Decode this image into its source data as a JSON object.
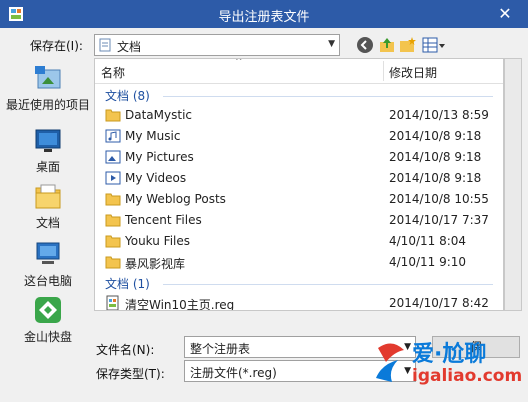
{
  "window": {
    "title": "导出注册表文件",
    "close_label": "✕"
  },
  "toolbar": {
    "save_in_label": "保存在(I):",
    "save_in_value": "文档"
  },
  "places": [
    {
      "label": "最近使用的项目",
      "icon": "recent-items-icon"
    },
    {
      "label": "桌面",
      "icon": "desktop-icon"
    },
    {
      "label": "文档",
      "icon": "documents-icon"
    },
    {
      "label": "这台电脑",
      "icon": "computer-icon"
    },
    {
      "label": "金山快盘",
      "icon": "kuaipan-icon"
    }
  ],
  "list": {
    "col_name": "名称",
    "col_date": "修改日期",
    "group1": "文档 (8)",
    "group2": "文档 (1)",
    "rows": [
      {
        "name": "DataMystic",
        "date": "2014/10/13 8:59"
      },
      {
        "name": "My Music",
        "date": "2014/10/8 9:18"
      },
      {
        "name": "My Pictures",
        "date": "2014/10/8 9:18"
      },
      {
        "name": "My Videos",
        "date": "2014/10/8 9:18"
      },
      {
        "name": "My Weblog Posts",
        "date": "2014/10/8 10:55"
      },
      {
        "name": "Tencent Files",
        "date": "2014/10/17 7:37"
      },
      {
        "name": "Youku Files",
        "date": "4/10/11 8:04"
      },
      {
        "name": "暴风影视库",
        "date": "4/10/11 9:10"
      }
    ],
    "reg_row": {
      "name": "清空Win10主页.reg",
      "date": "2014/10/17 8:42"
    }
  },
  "bottom": {
    "filename_label": "文件名(N):",
    "filename_value": "整个注册表",
    "filetype_label": "保存类型(T):",
    "filetype_value": "注册文件(*.reg)",
    "save_button": "保"
  },
  "watermark": {
    "line1": "爱·尬聊",
    "line2": "igaliao.com"
  },
  "colors": {
    "titlebar": "#2d5ba8",
    "group_text": "#1e4fa0",
    "folder": "#f3c44e"
  }
}
